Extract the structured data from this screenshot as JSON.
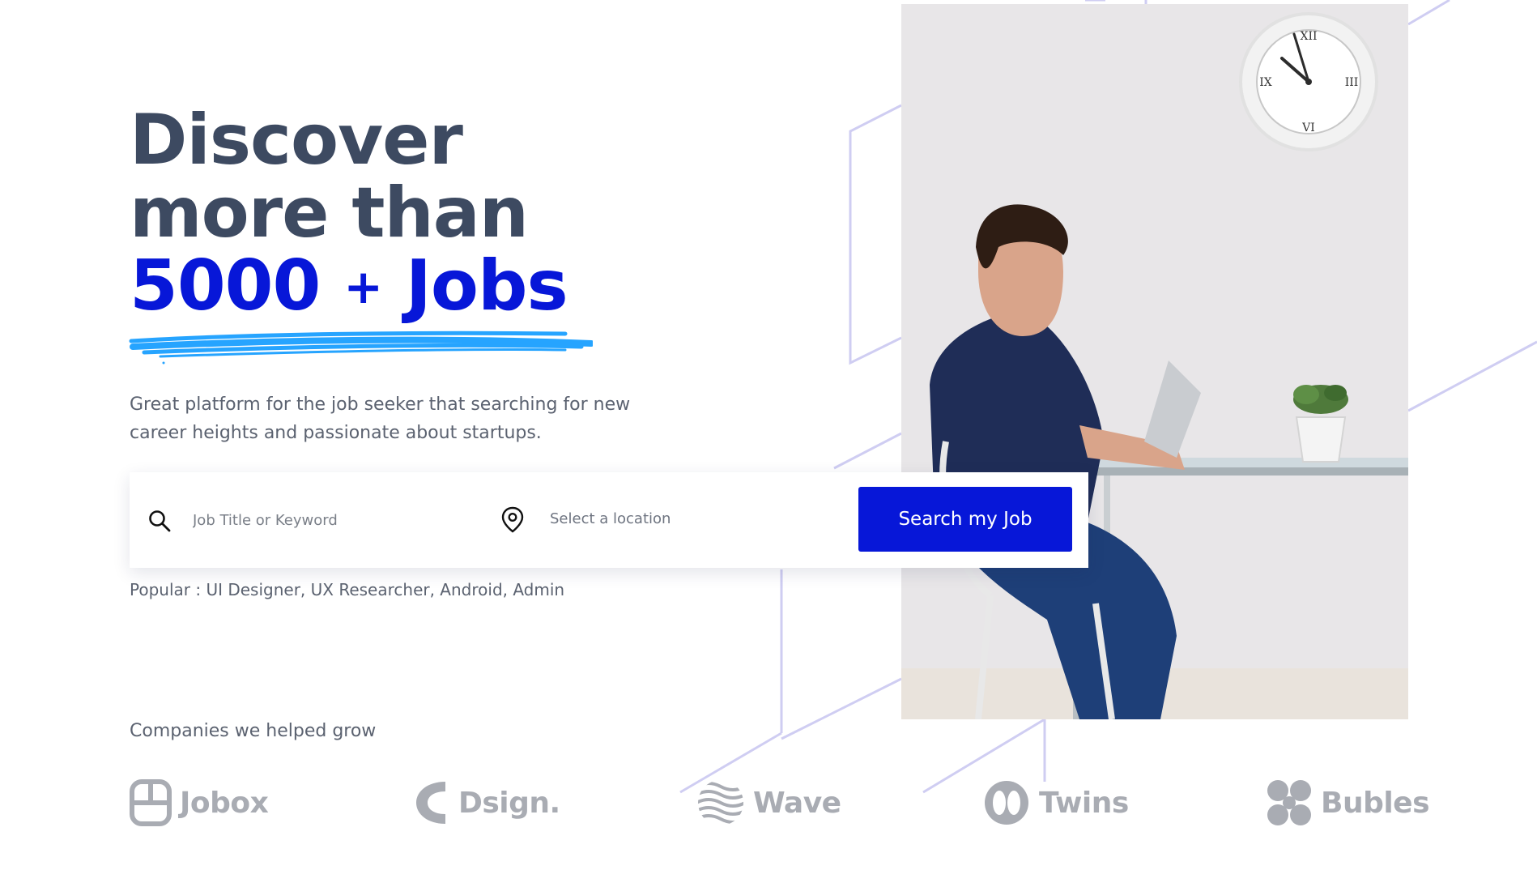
{
  "hero": {
    "title_line1": "Discover",
    "title_line2": "more than",
    "title_number": "5000",
    "title_plus": "+",
    "title_jobs": "Jobs",
    "subtitle": "Great platform for the job seeker that searching for new career heights and passionate about startups."
  },
  "search": {
    "keyword_placeholder": "Job Title or Keyword",
    "location_text": "Select a location",
    "button_label": "Search my Job"
  },
  "popular": "Popular : UI Designer, UX Researcher, Android, Admin",
  "companies": {
    "label": "Companies we helped grow",
    "logos": [
      {
        "name": "Jobox",
        "icon": "jobox-logo-icon"
      },
      {
        "name": "Dsign.",
        "icon": "dsign-logo-icon"
      },
      {
        "name": "Wave",
        "icon": "wave-logo-icon"
      },
      {
        "name": "Twins",
        "icon": "twins-logo-icon"
      },
      {
        "name": "Bubles",
        "icon": "bubles-logo-icon"
      }
    ]
  },
  "colors": {
    "accent": "#0717d8",
    "heading": "#3d4a61",
    "underline": "#26a4ff",
    "line_decoration": "#cfcdf2",
    "logo_gray": "#a9acb3"
  }
}
